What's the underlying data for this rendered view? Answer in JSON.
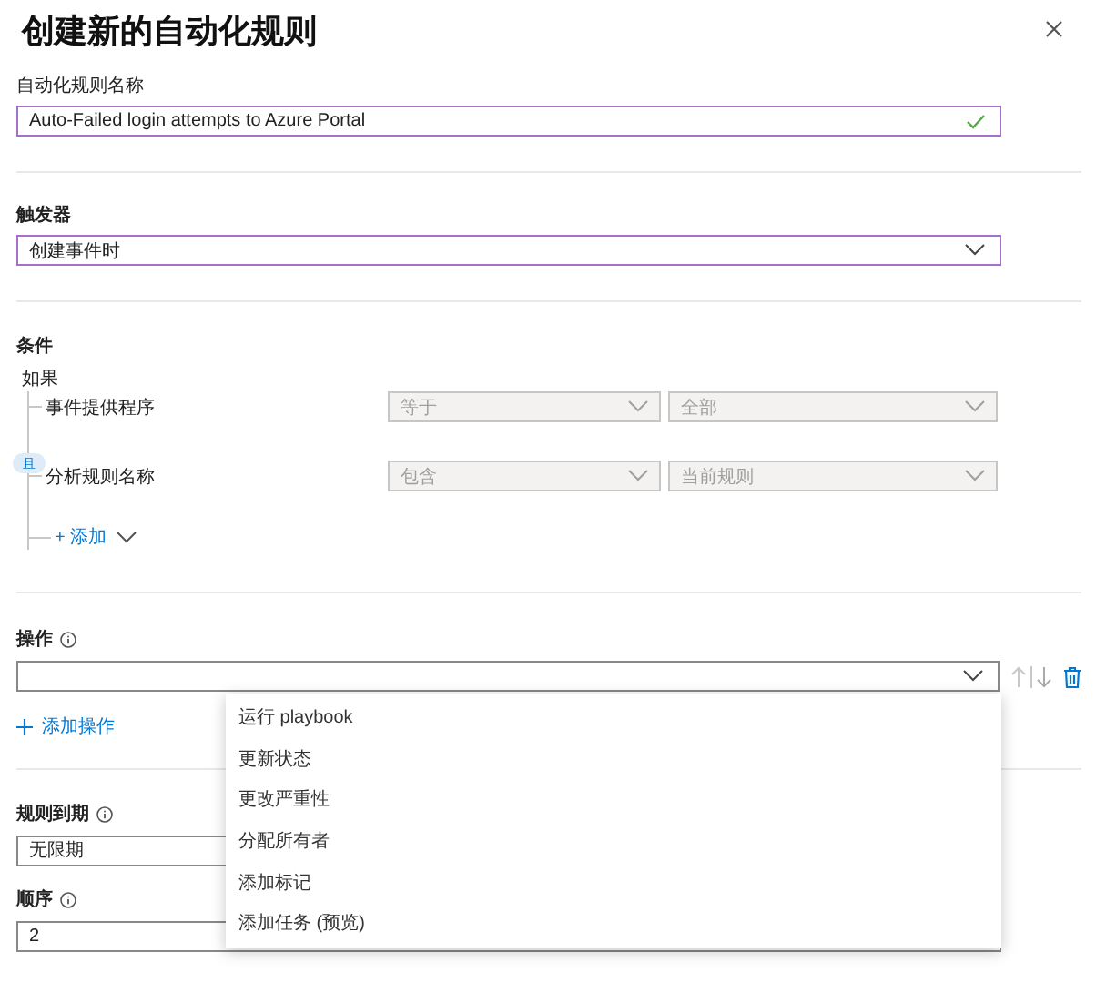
{
  "dialog": {
    "title": "创建新的自动化规则"
  },
  "rule_name": {
    "label": "自动化规则名称",
    "value": "Auto-Failed login attempts to Azure Portal",
    "valid": true
  },
  "trigger": {
    "label": "触发器",
    "value": "创建事件时"
  },
  "conditions": {
    "label": "条件",
    "if_label": "如果",
    "joiner": "且",
    "add_label": "+ 添加",
    "rows": [
      {
        "property": "事件提供程序",
        "operator": "等于",
        "value": "全部",
        "disabled": true
      },
      {
        "property": "分析规则名称",
        "operator": "包含",
        "value": "当前规则",
        "disabled": true
      }
    ]
  },
  "actions": {
    "label": "操作",
    "expanded": true,
    "add_label": "添加操作",
    "menu_items": [
      {
        "label": "运行 playbook"
      },
      {
        "label": "更新状态"
      },
      {
        "label": "更改严重性"
      },
      {
        "label": "分配所有者"
      },
      {
        "label": "添加标记"
      },
      {
        "label": "添加任务 (预览)"
      }
    ]
  },
  "expiration": {
    "label": "规则到期",
    "value": "无限期"
  },
  "order": {
    "label": "顺序",
    "value": "2"
  }
}
